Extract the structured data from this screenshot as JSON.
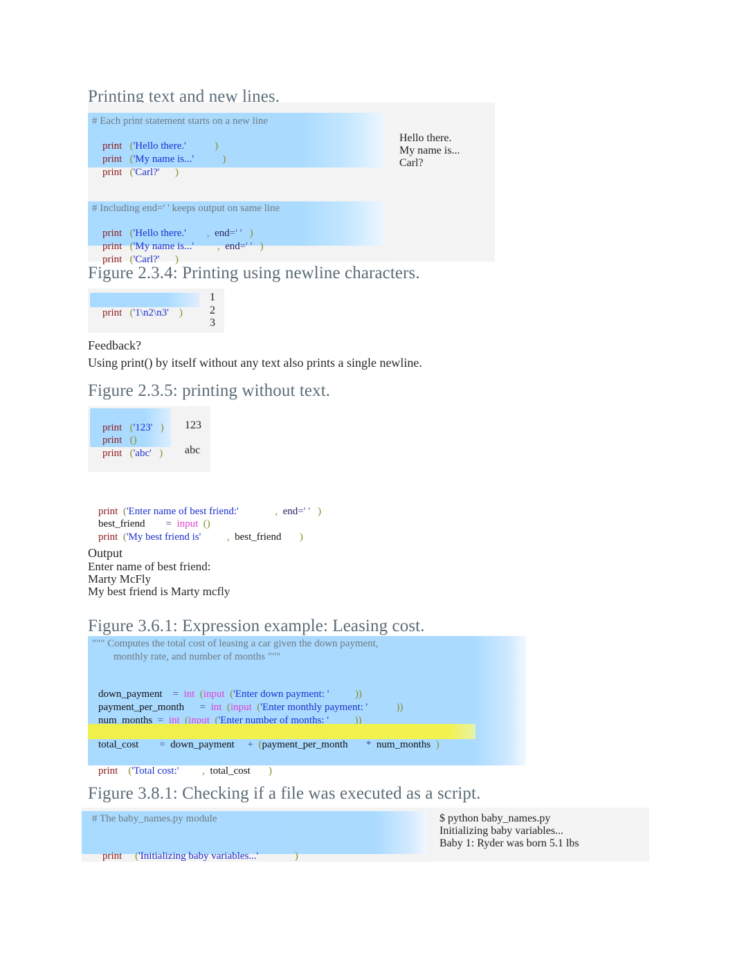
{
  "document": {
    "title": "Printing text and new lines."
  },
  "section1": {
    "heading": "Printing text and new lines.",
    "block1": {
      "comment": "# Each print statement starts on a new line",
      "lines": [
        {
          "kw": "print",
          "open": "(",
          "str": "'Hello there.'",
          "close": ")"
        },
        {
          "kw": "print",
          "open": "(",
          "str": "'My name is...'",
          "close": ")"
        },
        {
          "kw": "print",
          "open": "(",
          "str": "'Carl?'",
          "close": ")"
        }
      ]
    },
    "block2": {
      "comment": "# Including end=' ' keeps output on same line",
      "lines": [
        {
          "kw": "print",
          "open": "(",
          "str": "'Hello there.'",
          "comma": ",",
          "end": "end",
          "eq": "=' '",
          "close": ")"
        },
        {
          "kw": "print",
          "open": "(",
          "str": "'My name is...'",
          "comma": ",",
          "end": "end",
          "eq": "=' '",
          "close": ")"
        },
        {
          "kw": "print",
          "open": "(",
          "str": "'Carl?'",
          "close": ")"
        }
      ]
    },
    "output": [
      "Hello there.",
      "My name is...",
      "Carl?"
    ]
  },
  "section2": {
    "heading": "Figure 2.3.4: Printing using newline characters.",
    "code": {
      "kw": "print",
      "open": "(",
      "str": "'1\\n2\\n3'",
      "close": ")"
    },
    "output": [
      "1",
      "2",
      "3"
    ],
    "feedback_label": "Feedback?",
    "feedback_text": "Using print() by itself without any text also prints a single newline."
  },
  "section3": {
    "heading": "Figure 2.3.5: printing without text.",
    "lines": [
      {
        "kw": "print",
        "open": "(",
        "str": "'123'",
        "close": ")"
      },
      {
        "kw": "print",
        "open": "()",
        "str": "",
        "close": ""
      },
      {
        "kw": "print",
        "open": "(",
        "str": "'abc'",
        "close": ")"
      }
    ],
    "output": [
      "123",
      "abc"
    ]
  },
  "section4": {
    "code": {
      "line1": {
        "kw": "print",
        "open": "(",
        "str": "'Enter name of best friend:'",
        "comma": ",",
        "end": "end",
        "eq": "=' '",
        "close": ")"
      },
      "line2": {
        "var": "best_friend",
        "eq": "=",
        "func": "input",
        "parens": "()"
      },
      "line3": {
        "kw": "print",
        "open": "(",
        "str": "'My best friend is'",
        "comma": ",",
        "var": "best_friend",
        "close": ")"
      }
    },
    "output_label": "Output",
    "output": [
      "Enter name of best friend:",
      "Marty McFly",
      "My best friend is Marty mcfly"
    ]
  },
  "section5": {
    "heading": "Figure 3.6.1: Expression example: Leasing cost.",
    "docstring_line1": "\"\"\" Computes the total cost of leasing a car given the down payment,",
    "docstring_line2": "monthly rate, and number of months \"\"\"",
    "assign1": {
      "var": "down_payment",
      "eq": "=",
      "cast": "int",
      "p1": "(",
      "func": "input",
      "p2": "(",
      "str": "'Enter down payment: '",
      "close": "))"
    },
    "assign2": {
      "var": "payment_per_month",
      "eq": "=",
      "cast": "int",
      "p1": "(",
      "func": "input",
      "p2": "(",
      "str": "'Enter monthly payment: '",
      "close": "))"
    },
    "assign3": {
      "var": "num_months",
      "eq": "=",
      "cast": "int",
      "p1": "(",
      "func": "input",
      "p2": "(",
      "str": "'Enter number of months: '",
      "close": "))"
    },
    "highlighted": {
      "var": "total_cost",
      "eq": "=",
      "a": "down_payment",
      "plus": "+",
      "open": "(",
      "b": "payment_per_month",
      "star": "*",
      "c": "num_months",
      "close": ")"
    },
    "printline": {
      "kw": "print",
      "open": "(",
      "str": "'Total cost:'",
      "comma": ",",
      "var": "total_cost",
      "close": ")"
    }
  },
  "section6": {
    "heading": "Figure 3.8.1: Checking if a file was executed as a script.",
    "comment": "# The baby_names.py module",
    "code": {
      "kw": "print",
      "open": "(",
      "str": "'Initializing baby variables...'",
      "close": ")"
    },
    "output": [
      "$ python baby_names.py",
      "Initializing baby variables...",
      "Baby 1: Ryder was born 5.1 lbs"
    ]
  },
  "colors": {
    "heading": "#5a6b76",
    "code_bg": "#aadbff",
    "panel_bg": "#f3f3f3",
    "highlight": "#f0f04a",
    "keyword": "#8c1b1b",
    "string": "#1a2ecc",
    "paren": "#8a8a2b",
    "function": "#e23fd0",
    "comment": "#6f7a80"
  }
}
